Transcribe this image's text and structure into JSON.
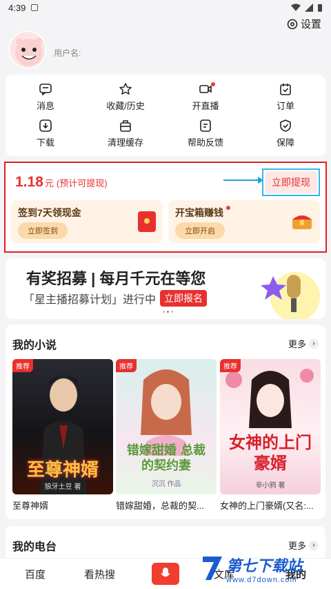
{
  "status": {
    "time": "4:39"
  },
  "header": {
    "settings_label": "设置",
    "username_label": "用户名:"
  },
  "grid": {
    "items": [
      {
        "label": "消息",
        "icon": "message-icon"
      },
      {
        "label": "收藏/历史",
        "icon": "star-icon"
      },
      {
        "label": "开直播",
        "icon": "video-icon",
        "dot": true
      },
      {
        "label": "订单",
        "icon": "order-icon"
      },
      {
        "label": "下载",
        "icon": "download-icon"
      },
      {
        "label": "清理缓存",
        "icon": "cache-icon"
      },
      {
        "label": "帮助反馈",
        "icon": "feedback-icon"
      },
      {
        "label": "保障",
        "icon": "shield-icon"
      }
    ]
  },
  "earnings": {
    "amount": "1.18",
    "unit": "元",
    "note": "(预计可提现)",
    "withdraw_label": "立即提现",
    "tasks": [
      {
        "title": "签到7天领现金",
        "button": "立即签到"
      },
      {
        "title": "开宝箱赚钱",
        "button": "立即开启"
      }
    ]
  },
  "banner": {
    "title": "有奖招募 | 每月千元在等您",
    "subtitle": "「星主播招募计划」进行中",
    "badge": "立即报名"
  },
  "novels": {
    "title": "我的小说",
    "more_label": "更多",
    "books": [
      {
        "tag": "推荐",
        "cover_title": "至尊神婿",
        "author": "狼牙土豆 著",
        "name": "至尊神婿"
      },
      {
        "tag": "推荐",
        "cover_title": "错嫁甜婚 总裁的契约妻",
        "author": "沉沉 作品",
        "name": "错嫁甜婚，总裁的契..."
      },
      {
        "tag": "推荐",
        "cover_title": "女神的上门豪婿",
        "author": "非小鸦 著",
        "name": "女神的上门豪婿(又名:..."
      }
    ]
  },
  "radio": {
    "title": "我的电台",
    "more_label": "更多"
  },
  "tabbar": {
    "tabs": [
      "百度",
      "看热搜",
      "文库",
      "我的"
    ]
  },
  "watermark": {
    "text": "第七下载站",
    "url": "www.d7down.com"
  }
}
